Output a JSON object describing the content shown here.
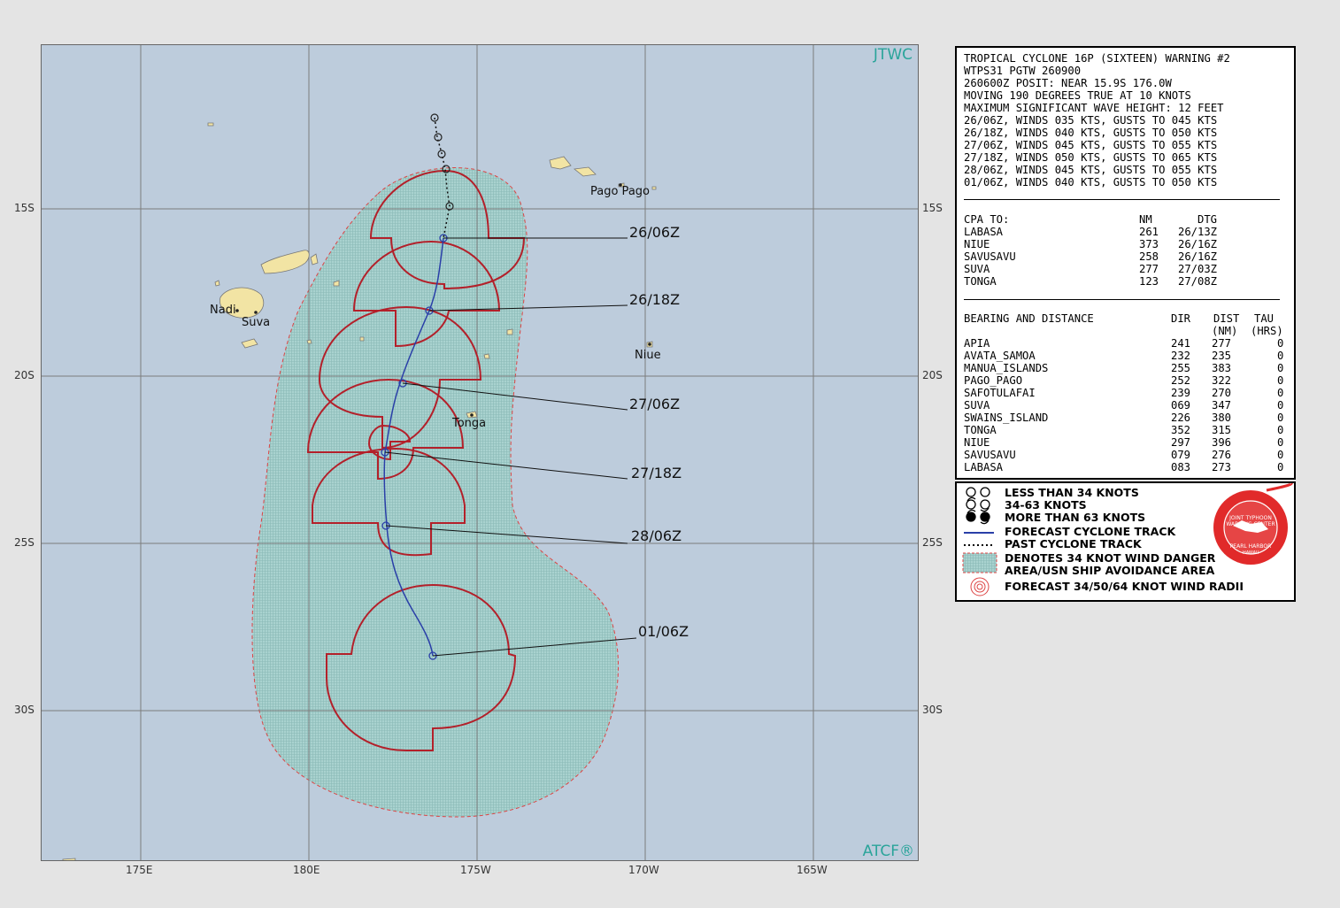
{
  "map": {
    "corner_top_right": "JTWC",
    "corner_bottom_right": "ATCF®",
    "lat_labels": [
      "15S",
      "20S",
      "25S",
      "30S"
    ],
    "lon_labels": [
      "175E",
      "180E",
      "175W",
      "170W",
      "165W"
    ],
    "places": {
      "pago_pago": "Pago Pago",
      "nadi": "Nadi",
      "suva": "Suva",
      "niue": "Niue",
      "tonga": "Tonga"
    },
    "forecast_labels": [
      "26/06Z",
      "26/18Z",
      "27/06Z",
      "27/18Z",
      "28/06Z",
      "01/06Z"
    ],
    "colors": {
      "ocean": "#bdccdc",
      "land": "#f2e4a4",
      "danger_area": "#a6cfcd",
      "wind_radii": "#b3202a",
      "forecast_track": "#2a3fa8",
      "grid": "#777777"
    }
  },
  "warning": {
    "lines": [
      "TROPICAL CYCLONE 16P (SIXTEEN) WARNING #2",
      "WTPS31 PGTW 260900",
      "260600Z POSIT: NEAR 15.9S 176.0W",
      "MOVING 190 DEGREES TRUE AT 10 KNOTS",
      "MAXIMUM SIGNIFICANT WAVE HEIGHT: 12 FEET",
      "26/06Z, WINDS 035 KTS, GUSTS TO 045 KTS",
      "26/18Z, WINDS 040 KTS, GUSTS TO 050 KTS",
      "27/06Z, WINDS 045 KTS, GUSTS TO 055 KTS",
      "27/18Z, WINDS 050 KTS, GUSTS TO 065 KTS",
      "28/06Z, WINDS 045 KTS, GUSTS TO 055 KTS",
      "01/06Z, WINDS 040 KTS, GUSTS TO 050 KTS"
    ]
  },
  "cpa": {
    "header": {
      "to": "CPA TO:",
      "nm": "NM",
      "dtg": "DTG"
    },
    "rows": [
      {
        "name": "LABASA",
        "nm": "261",
        "dtg": "26/13Z"
      },
      {
        "name": "NIUE",
        "nm": "373",
        "dtg": "26/16Z"
      },
      {
        "name": "SAVUSAVU",
        "nm": "258",
        "dtg": "26/16Z"
      },
      {
        "name": "SUVA",
        "nm": "277",
        "dtg": "27/03Z"
      },
      {
        "name": "TONGA",
        "nm": "123",
        "dtg": "27/08Z"
      }
    ]
  },
  "bearing": {
    "header": {
      "title": "BEARING AND DISTANCE",
      "dir": "DIR",
      "dist": "DIST",
      "tau": "TAU",
      "dist_unit": "(NM)",
      "tau_unit": "(HRS)"
    },
    "rows": [
      {
        "name": "APIA",
        "dir": "241",
        "dist": "277",
        "tau": "0"
      },
      {
        "name": "AVATA_SAMOA",
        "dir": "232",
        "dist": "235",
        "tau": "0"
      },
      {
        "name": "MANUA_ISLANDS",
        "dir": "255",
        "dist": "383",
        "tau": "0"
      },
      {
        "name": "PAGO_PAGO",
        "dir": "252",
        "dist": "322",
        "tau": "0"
      },
      {
        "name": "SAFOTULAFAI",
        "dir": "239",
        "dist": "270",
        "tau": "0"
      },
      {
        "name": "SUVA",
        "dir": "069",
        "dist": "347",
        "tau": "0"
      },
      {
        "name": "SWAINS_ISLAND",
        "dir": "226",
        "dist": "380",
        "tau": "0"
      },
      {
        "name": "TONGA",
        "dir": "352",
        "dist": "315",
        "tau": "0"
      },
      {
        "name": "NIUE",
        "dir": "297",
        "dist": "396",
        "tau": "0"
      },
      {
        "name": "SAVUSAVU",
        "dir": "079",
        "dist": "276",
        "tau": "0"
      },
      {
        "name": "LABASA",
        "dir": "083",
        "dist": "273",
        "tau": "0"
      }
    ]
  },
  "legend": {
    "items": [
      "LESS THAN 34 KNOTS",
      "34-63 KNOTS",
      "MORE THAN 63 KNOTS",
      "FORECAST CYCLONE TRACK",
      "PAST CYCLONE TRACK",
      "DENOTES 34 KNOT WIND DANGER",
      "AREA/USN SHIP AVOIDANCE AREA",
      "FORECAST 34/50/64 KNOT WIND RADII"
    ],
    "seal": {
      "text_top": "JOINT TYPHOON WARNING CENTER",
      "text_bottom": "PEARL HARBOR",
      "text_state": "HAWAII"
    }
  }
}
